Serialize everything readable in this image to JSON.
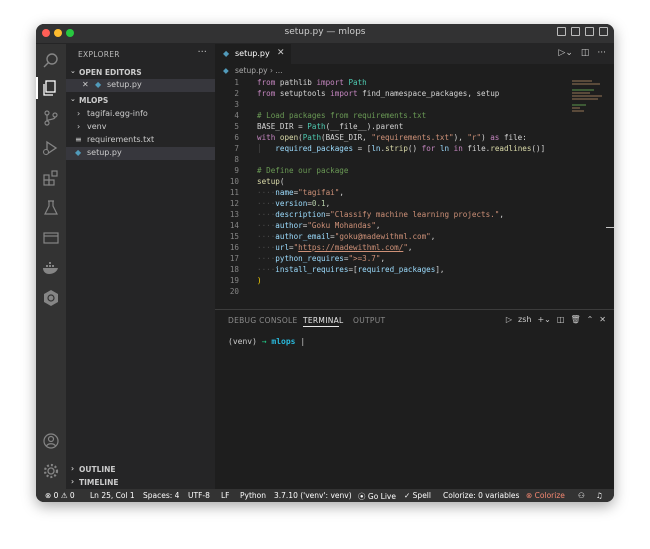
{
  "window": {
    "title": "setup.py — mlops"
  },
  "sidebar": {
    "header": "EXPLORER",
    "more": "···",
    "open_editors_label": "OPEN EDITORS",
    "open_editors": [
      {
        "close": "✕",
        "name": "setup.py"
      }
    ],
    "project_label": "MLOPS",
    "tree": [
      {
        "chevron": "›",
        "name": "tagifai.egg-info"
      },
      {
        "chevron": "›",
        "name": "venv"
      },
      {
        "icon": "≡",
        "name": "requirements.txt"
      },
      {
        "icon": "py",
        "name": "setup.py"
      }
    ],
    "outline_label": "OUTLINE",
    "timeline_label": "TIMELINE",
    "accounts_badge": "1"
  },
  "editor": {
    "tab_label": "setup.py",
    "tab_close": "✕",
    "breadcrumb": "setup.py › ...",
    "line_numbers": [
      "1",
      "2",
      "3",
      "4",
      "5",
      "6",
      "7",
      "8",
      "9",
      "10",
      "11",
      "12",
      "13",
      "14",
      "15",
      "16",
      "17",
      "18",
      "19",
      "20"
    ],
    "code": {
      "l1": [
        "from",
        " pathlib ",
        "import",
        " Path"
      ],
      "l2": [
        "from",
        " setuptools ",
        "import",
        " find_namespace_packages, setup"
      ],
      "l4": "# Load packages from requirements.txt",
      "l5": [
        "BASE_DIR",
        " = ",
        "Path",
        "(__file__).parent"
      ],
      "l6": [
        "with",
        " open",
        "(",
        "Path",
        "(BASE_DIR, ",
        "\"requirements.txt\"",
        "), ",
        "\"r\"",
        ") ",
        "as",
        " file:"
      ],
      "l7": [
        "required_packages",
        " = [",
        "ln",
        ".",
        "strip",
        "() ",
        "for",
        " ",
        "ln",
        " ",
        "in",
        " file.",
        "readlines",
        "()]"
      ],
      "l9": "# Define our package",
      "l10": [
        "setup",
        "("
      ],
      "l11": [
        "name",
        "=",
        "\"tagifai\"",
        ","
      ],
      "l12": [
        "version",
        "=",
        "0.1",
        ","
      ],
      "l13": [
        "description",
        "=",
        "\"Classify machine learning projects.\"",
        ","
      ],
      "l14": [
        "author",
        "=",
        "\"Goku Mohandas\"",
        ","
      ],
      "l15": [
        "author_email",
        "=",
        "\"goku@madewithml.com\"",
        ","
      ],
      "l16": [
        "url",
        "=",
        "\"",
        "https://madewithml.com/",
        "\"",
        ","
      ],
      "l17": [
        "python_requires",
        "=",
        "\">=3.7\"",
        ","
      ],
      "l18": [
        "install_requires",
        "=[",
        "required_packages",
        "],"
      ],
      "l19": ")"
    }
  },
  "panel": {
    "tabs": [
      "DEBUG CONSOLE",
      "TERMINAL",
      "OUTPUT"
    ],
    "shell": "zsh",
    "prompt_env": "(venv)",
    "prompt_arrow": "→",
    "prompt_dir": "mlops"
  },
  "status": {
    "problems": "⊗ 0 ⚠ 0",
    "cursor": "Ln 25, Col 1",
    "spaces": "Spaces: 4",
    "encoding": "UTF-8",
    "eol": "LF",
    "language": "Python",
    "interpreter": "3.7.10 ('venv': venv)",
    "golive": "Go Live",
    "spell": "✓ Spell",
    "colorize_vars": "Colorize: 0 variables",
    "colorize": "⊗ Colorize"
  },
  "colors": {
    "keyword": "#c586c0",
    "class": "#4ec9b0",
    "string": "#ce9178",
    "comment": "#6a9955",
    "number": "#b5cea8",
    "param": "#9cdcfe",
    "function": "#dcdcaa"
  }
}
